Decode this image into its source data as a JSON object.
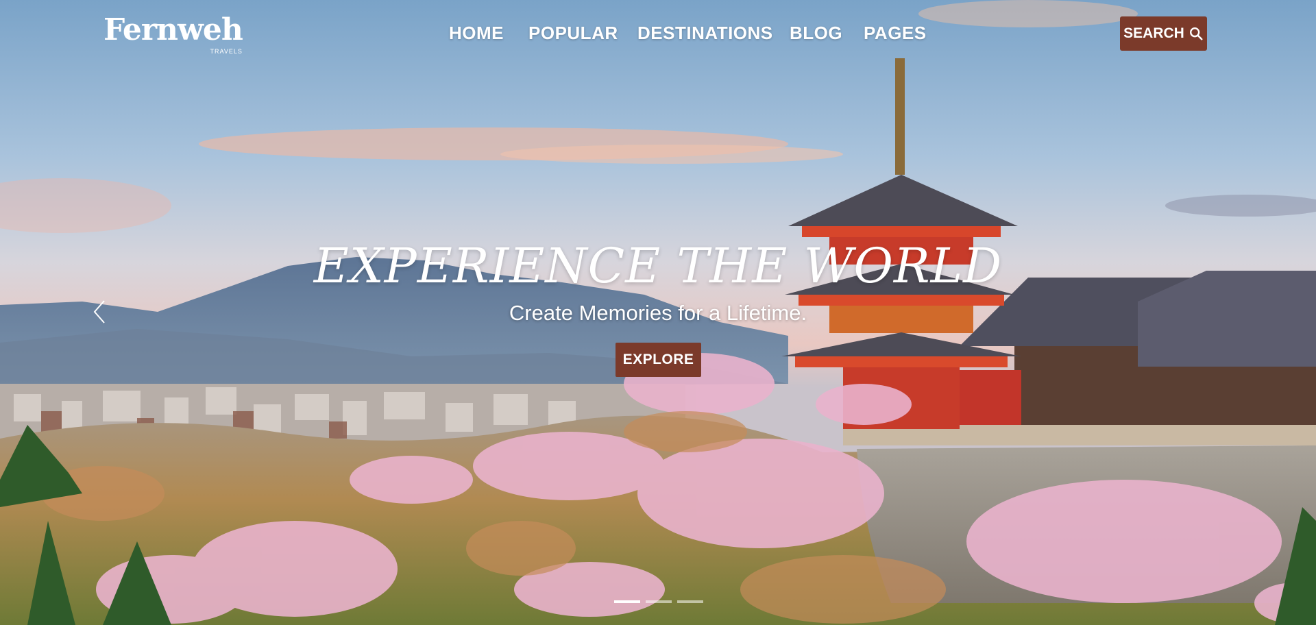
{
  "header": {
    "logo": {
      "name": "Fernweh",
      "tagline": "TRAVELS"
    },
    "nav": [
      {
        "label": "HOME"
      },
      {
        "label": "POPULAR"
      },
      {
        "label": "DESTINATIONS"
      },
      {
        "label": "BLOG"
      },
      {
        "label": "PAGES"
      }
    ],
    "search": {
      "label": "SEARCH",
      "icon": "search-icon"
    }
  },
  "hero": {
    "headline": "EXPERIENCE THE WORLD",
    "subheadline": "Create Memories for a Lifetime.",
    "cta_label": "EXPLORE",
    "prev_icon": "chevron-left-icon",
    "slides": {
      "count": 3,
      "active_index": 0
    }
  },
  "colors": {
    "accent": "#7b3a2a",
    "text": "#ffffff",
    "sky_top": "#7fa6cb",
    "sky_horizon": "#e6c6c2"
  }
}
